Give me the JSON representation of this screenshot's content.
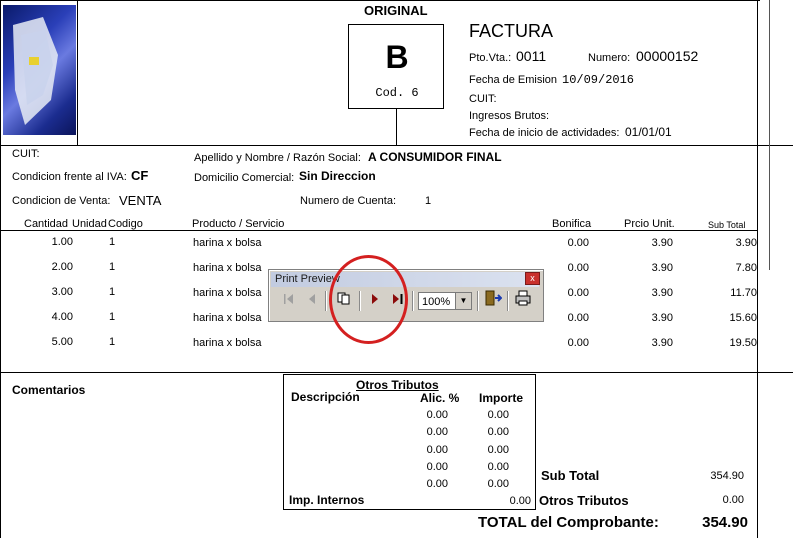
{
  "header": {
    "original": "ORIGINAL",
    "letter": "B",
    "cod": "Cod. 6",
    "factura": "FACTURA",
    "pto_vta_label": "Pto.Vta.:",
    "pto_vta": "0011",
    "numero_label": "Numero:",
    "numero": "00000152",
    "fecha_emision_label": "Fecha de Emision",
    "fecha_emision": "10/09/2016",
    "cuit_label": "CUIT:",
    "ingresos_label": "Ingresos Brutos:",
    "inicio_label": "Fecha de inicio de actividades:",
    "inicio": "01/01/01"
  },
  "client": {
    "cuit_label": "CUIT:",
    "iva_label": "Condicion frente al IVA:",
    "iva": "CF",
    "venta_label": "Condicion de Venta:",
    "venta": "VENTA",
    "nombre_label": "Apellido y Nombre / Razón Social:",
    "nombre": "A CONSUMIDOR FINAL",
    "domicilio_label": "Domicilio Comercial:",
    "domicilio": "Sin Direccion",
    "cuenta_label": "Numero de Cuenta:",
    "cuenta": "1"
  },
  "table": {
    "headers": {
      "cantidad": "Cantidad",
      "unidad": "Unidad",
      "codigo": "Codigo",
      "producto": "Producto / Servicio",
      "bonifica": "Bonifica",
      "precio": "Prcio Unit.",
      "subtotal": "Sub Total"
    },
    "rows": [
      {
        "cantidad": "1.00",
        "unidad": "1",
        "producto": "harina x bolsa",
        "bonifica": "0.00",
        "precio": "3.90",
        "subtotal": "3.90"
      },
      {
        "cantidad": "2.00",
        "unidad": "1",
        "producto": "harina x bolsa",
        "bonifica": "0.00",
        "precio": "3.90",
        "subtotal": "7.80"
      },
      {
        "cantidad": "3.00",
        "unidad": "1",
        "producto": "harina x bolsa",
        "bonifica": "0.00",
        "precio": "3.90",
        "subtotal": "11.70"
      },
      {
        "cantidad": "4.00",
        "unidad": "1",
        "producto": "harina x bolsa",
        "bonifica": "0.00",
        "precio": "3.90",
        "subtotal": "15.60"
      },
      {
        "cantidad": "5.00",
        "unidad": "1",
        "producto": "harina x bolsa",
        "bonifica": "0.00",
        "precio": "3.90",
        "subtotal": "19.50"
      }
    ]
  },
  "comentarios": "Comentarios",
  "tributos": {
    "title": "Otros Tributos",
    "descripcion": "Descripción",
    "alic": "Alic. %",
    "importe": "Importe",
    "rows": [
      {
        "alic": "0.00",
        "importe": "0.00"
      },
      {
        "alic": "0.00",
        "importe": "0.00"
      },
      {
        "alic": "0.00",
        "importe": "0.00"
      },
      {
        "alic": "0.00",
        "importe": "0.00"
      },
      {
        "alic": "0.00",
        "importe": "0.00"
      }
    ],
    "imp_internos_label": "Imp. Internos",
    "imp_internos": "0.00"
  },
  "totals": {
    "subtotal_label": "Sub Total",
    "subtotal": "354.90",
    "otros_label": "Otros Tributos",
    "otros": "0.00",
    "total_label": "TOTAL del Comprobante:",
    "total": "354.90"
  },
  "print_preview": {
    "title": "Print Preview",
    "close": "x",
    "zoom": "100%",
    "icons": [
      "first-page-icon",
      "prev-page-icon",
      "multi-page-icon",
      "next-page-icon",
      "last-page-icon",
      "exit-icon",
      "printer-icon"
    ],
    "highlight_color": "#d42020"
  }
}
